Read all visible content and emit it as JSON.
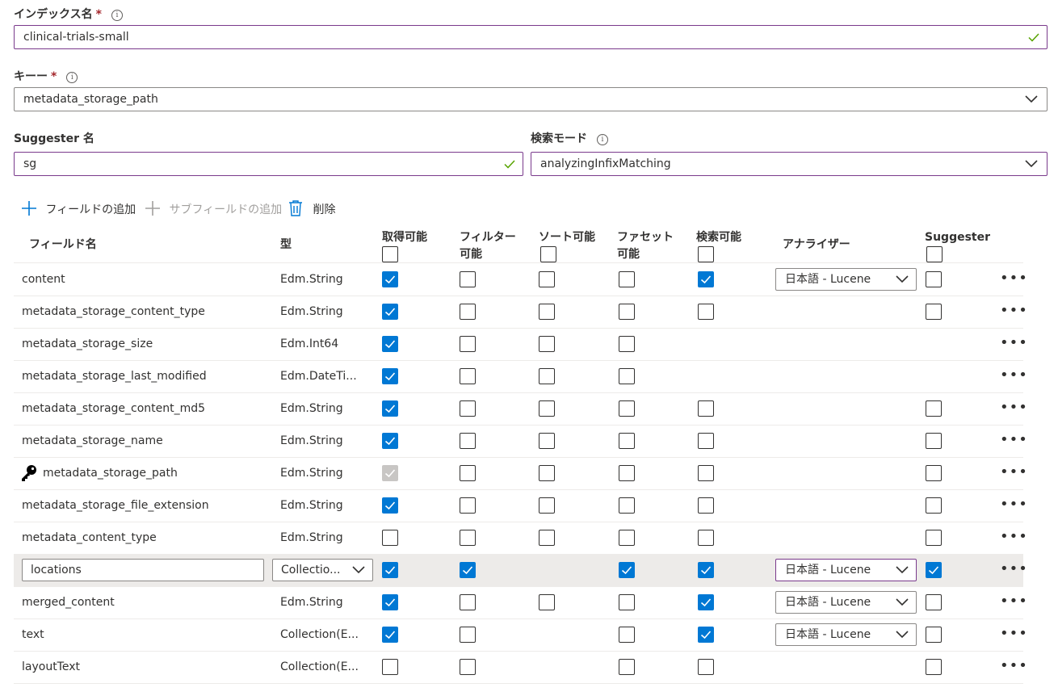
{
  "index_name": {
    "label": "インデックス名",
    "required_mark": "*",
    "value": "clinical-trials-small"
  },
  "key": {
    "label": "キー",
    "required_mark": "*",
    "value": "metadata_storage_path"
  },
  "suggester": {
    "label": "Suggester 名",
    "value": "sg"
  },
  "search_mode": {
    "label": "検索モード",
    "value": "analyzingInfixMatching"
  },
  "toolbar": {
    "add_field": "フィールドの追加",
    "add_subfield": "サブフィールドの追加",
    "delete": "削除"
  },
  "columns": {
    "name": "フィールド名",
    "type": "型",
    "retrievable": "取得可能",
    "filterable": "フィルター可能",
    "sortable": "ソート可能",
    "facetable": "ファセット可能",
    "searchable": "検索可能",
    "analyzer": "アナライザー",
    "suggester": "Suggester"
  },
  "accent_color": "#0078d4",
  "rows": [
    {
      "name": "content",
      "type": "Edm.String",
      "retrievable": true,
      "filterable": false,
      "sortable": false,
      "facetable": false,
      "searchable": true,
      "analyzer": "日本語 - Lucene",
      "suggester": false
    },
    {
      "name": "metadata_storage_content_type",
      "type": "Edm.String",
      "retrievable": true,
      "filterable": false,
      "sortable": false,
      "facetable": false,
      "searchable": false,
      "suggester": false
    },
    {
      "name": "metadata_storage_size",
      "type": "Edm.Int64",
      "retrievable": true,
      "filterable": false,
      "sortable": false,
      "facetable": false
    },
    {
      "name": "metadata_storage_last_modified",
      "type": "Edm.DateTi...",
      "retrievable": true,
      "filterable": false,
      "sortable": false,
      "facetable": false
    },
    {
      "name": "metadata_storage_content_md5",
      "type": "Edm.String",
      "retrievable": true,
      "filterable": false,
      "sortable": false,
      "facetable": false,
      "searchable": false,
      "suggester": false
    },
    {
      "name": "metadata_storage_name",
      "type": "Edm.String",
      "retrievable": true,
      "filterable": false,
      "sortable": false,
      "facetable": false,
      "searchable": false,
      "suggester": false
    },
    {
      "name": "metadata_storage_path",
      "type": "Edm.String",
      "key_icon": "key-icon",
      "retrievable": "disabled",
      "filterable": false,
      "sortable": false,
      "facetable": false,
      "searchable": false,
      "suggester": false
    },
    {
      "name": "metadata_storage_file_extension",
      "type": "Edm.String",
      "retrievable": true,
      "filterable": false,
      "sortable": false,
      "facetable": false,
      "searchable": false,
      "suggester": false
    },
    {
      "name": "metadata_content_type",
      "type": "Edm.String",
      "retrievable": false,
      "filterable": false,
      "sortable": false,
      "facetable": false,
      "searchable": false,
      "suggester": false
    },
    {
      "name": "locations",
      "type": "Collectio...",
      "editing": true,
      "retrievable": true,
      "filterable": true,
      "facetable": true,
      "searchable": true,
      "analyzer": "日本語 - Lucene",
      "suggester": true
    },
    {
      "name": "merged_content",
      "type": "Edm.String",
      "retrievable": true,
      "filterable": false,
      "sortable": false,
      "facetable": false,
      "searchable": true,
      "analyzer": "日本語 - Lucene",
      "suggester": false
    },
    {
      "name": "text",
      "type": "Collection(E...",
      "retrievable": true,
      "filterable": false,
      "facetable": false,
      "searchable": true,
      "analyzer": "日本語 - Lucene",
      "suggester": false
    },
    {
      "name": "layoutText",
      "type": "Collection(E...",
      "retrievable": false,
      "filterable": false,
      "facetable": false,
      "searchable": false,
      "suggester": false
    }
  ]
}
